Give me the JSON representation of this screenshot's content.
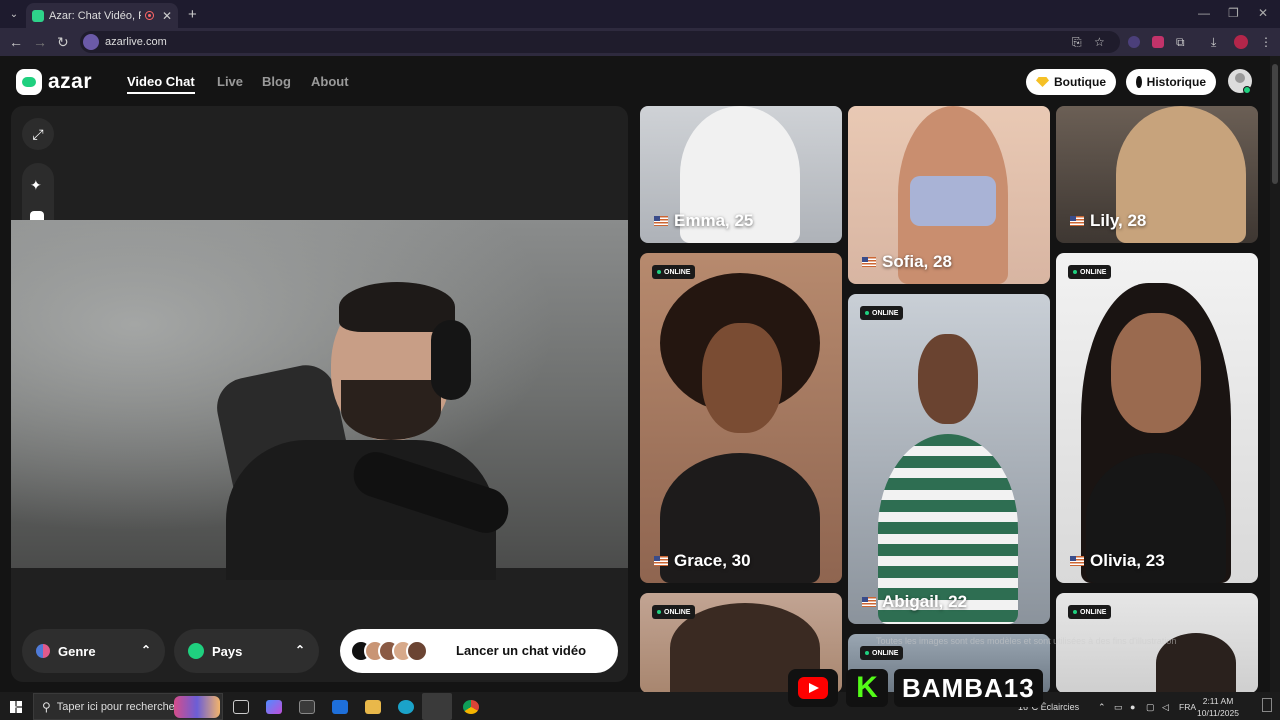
{
  "browser": {
    "tab_title": "Azar: Chat Vidéo, Rencontre",
    "tab_close": "✕",
    "new_tab": "+",
    "url": "azarlive.com",
    "menu_icon": "⌄",
    "min": "—",
    "restore": "❐",
    "close": "✕",
    "back": "←",
    "forward": "→",
    "reload": "↻"
  },
  "site": {
    "logo_text": "azar",
    "nav": [
      "Video Chat",
      "Live",
      "Blog",
      "About"
    ],
    "boutique": "Boutique",
    "historique": "Historique"
  },
  "video_panel": {
    "genre": "Genre",
    "pays": "Pays",
    "launch": "Lancer un chat vidéo",
    "sparkle": "✦",
    "expand": "⤢",
    "chevron": "⌃"
  },
  "cards": [
    {
      "name": "Emma, 25",
      "online": false
    },
    {
      "name": "Sofia, 28",
      "online": false
    },
    {
      "name": "Lily, 28",
      "online": false
    },
    {
      "name": "Grace, 30",
      "online": true
    },
    {
      "name": "Abigail, 22",
      "online": true
    },
    {
      "name": "Olivia, 23",
      "online": true
    },
    {
      "name": "",
      "online": true
    },
    {
      "name": "",
      "online": true
    },
    {
      "name": "",
      "online": true
    }
  ],
  "online_label": "ONLINE",
  "disclaimer": "Toutes les images sont des modèles et sont utilisées à des fins d'illustration",
  "overlay": {
    "kick": "K",
    "streamer": "BAMBA13"
  },
  "taskbar": {
    "search_placeholder": "Taper ici pour rechercher",
    "weather": "16°C  Éclaircies",
    "lang": "FRA",
    "time": "2:11 AM",
    "date": "10/11/2025"
  },
  "colors": {
    "accent": "#1fd07f",
    "background": "#141414",
    "panel": "#202020"
  }
}
